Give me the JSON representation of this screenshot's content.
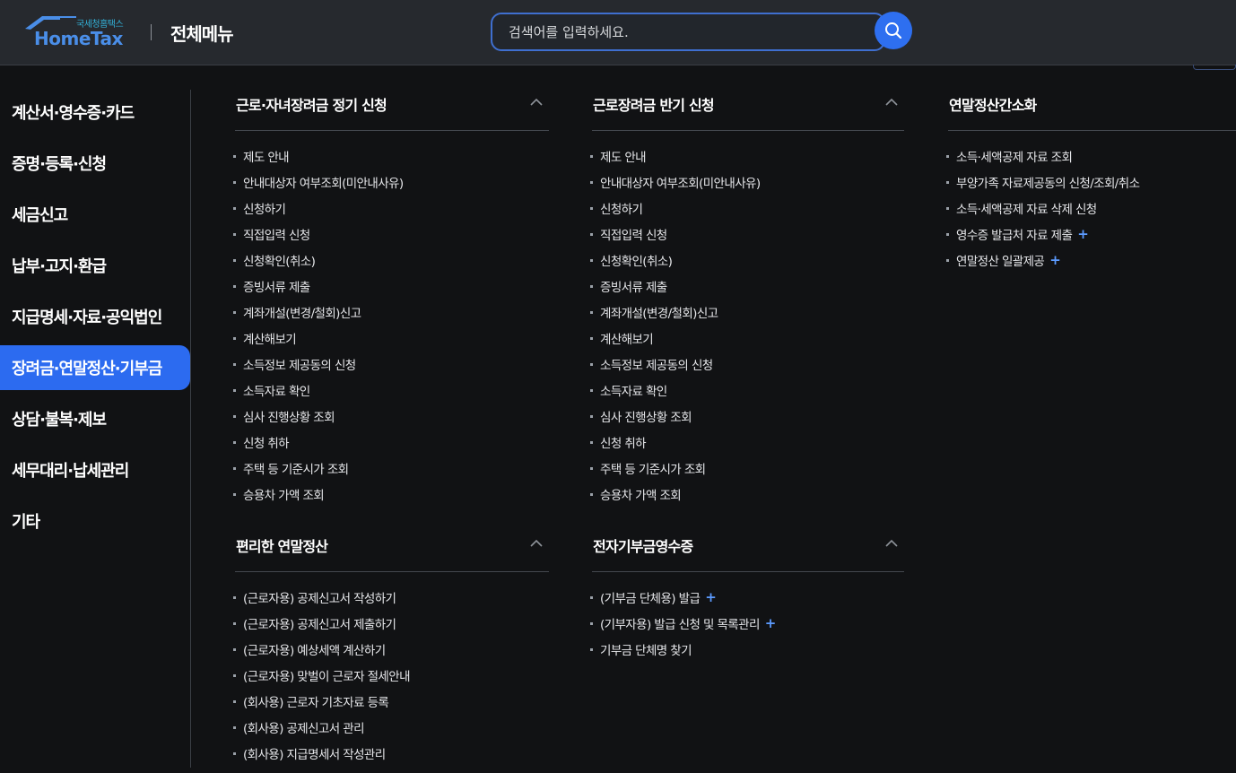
{
  "header": {
    "logo_sub": "국세청홈택스",
    "logo_main": "HomeTax",
    "title": "전체메뉴",
    "search_placeholder": "검색어를 입력하세요.",
    "search_icon": "search-icon"
  },
  "nav": {
    "items": [
      {
        "label": "계산서·영수증·카드",
        "active": false
      },
      {
        "label": "증명·등록·신청",
        "active": false
      },
      {
        "label": "세금신고",
        "active": false
      },
      {
        "label": "납부·고지·환급",
        "active": false
      },
      {
        "label": "지급명세·자료·공익법인",
        "active": false
      },
      {
        "label": "장려금·연말정산·기부금",
        "active": true
      },
      {
        "label": "상담·불복·제보",
        "active": false
      },
      {
        "label": "세무대리·납세관리",
        "active": false
      },
      {
        "label": "기타",
        "active": false
      }
    ]
  },
  "sections": {
    "s1": {
      "title": "근로·자녀장려금 정기 신청",
      "items": [
        {
          "label": "제도 안내"
        },
        {
          "label": "안내대상자 여부조회(미안내사유)"
        },
        {
          "label": "신청하기"
        },
        {
          "label": "직접입력 신청"
        },
        {
          "label": "신청확인(취소)"
        },
        {
          "label": "증빙서류 제출"
        },
        {
          "label": "계좌개설(변경/철회)신고"
        },
        {
          "label": "계산해보기"
        },
        {
          "label": "소득정보 제공동의 신청"
        },
        {
          "label": "소득자료 확인"
        },
        {
          "label": "심사 진행상황 조회"
        },
        {
          "label": "신청 취하"
        },
        {
          "label": "주택 등 기준시가 조회"
        },
        {
          "label": "승용차 가액 조회"
        }
      ]
    },
    "s2": {
      "title": "근로장려금 반기 신청",
      "items": [
        {
          "label": "제도 안내"
        },
        {
          "label": "안내대상자 여부조회(미안내사유)"
        },
        {
          "label": "신청하기"
        },
        {
          "label": "직접입력 신청"
        },
        {
          "label": "신청확인(취소)"
        },
        {
          "label": "증빙서류 제출"
        },
        {
          "label": "계좌개설(변경/철회)신고"
        },
        {
          "label": "계산해보기"
        },
        {
          "label": "소득정보 제공동의 신청"
        },
        {
          "label": "소득자료 확인"
        },
        {
          "label": "심사 진행상황 조회"
        },
        {
          "label": "신청 취하"
        },
        {
          "label": "주택 등 기준시가 조회"
        },
        {
          "label": "승용차 가액 조회"
        }
      ]
    },
    "s3": {
      "title": "연말정산간소화",
      "items": [
        {
          "label": "소득·세액공제 자료 조회",
          "plus": ""
        },
        {
          "label": "부양가족 자료제공동의 신청/조회/취소",
          "plus": ""
        },
        {
          "label": "소득·세액공제 자료 삭제 신청",
          "plus": ""
        },
        {
          "label": "영수증 발급처 자료 제출",
          "plus": "+"
        },
        {
          "label": "연말정산 일괄제공",
          "plus": "+"
        }
      ]
    },
    "s4": {
      "title": "편리한 연말정산",
      "items": [
        {
          "label": "(근로자용) 공제신고서 작성하기"
        },
        {
          "label": "(근로자용) 공제신고서 제출하기"
        },
        {
          "label": "(근로자용) 예상세액 계산하기"
        },
        {
          "label": "(근로자용) 맞벌이 근로자 절세안내"
        },
        {
          "label": "(회사용) 근로자 기초자료 등록"
        },
        {
          "label": "(회사용) 공제신고서 관리"
        },
        {
          "label": "(회사용) 지급명세서 작성관리"
        }
      ]
    },
    "s5": {
      "title": "전자기부금영수증",
      "items": [
        {
          "label": "(기부금 단체용) 발급",
          "plus": "+"
        },
        {
          "label": "(기부자용) 발급 신청 및 목록관리",
          "plus": "+"
        },
        {
          "label": "기부금 단체명 찾기",
          "plus": ""
        }
      ]
    }
  },
  "colors": {
    "background": "#111214",
    "header": "#26292e",
    "accent": "#2c6bf0",
    "plus": "#5c9bff"
  }
}
